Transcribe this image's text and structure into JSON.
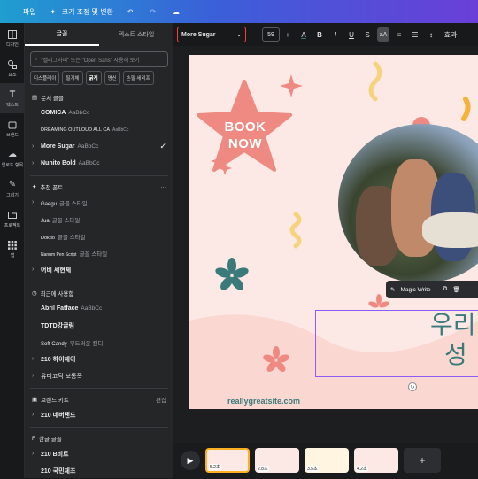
{
  "topbar": {
    "file_label": "파일",
    "resize_label": "크기 조정 및 변환",
    "undo": "undo-icon",
    "redo": "redo-icon",
    "cloud": "cloud-icon"
  },
  "rail": [
    {
      "label": "디자인"
    },
    {
      "label": "요소"
    },
    {
      "label": "텍스트"
    },
    {
      "label": "브랜드"
    },
    {
      "label": "업로드 항목"
    },
    {
      "label": "그리기"
    },
    {
      "label": "프로젝트"
    },
    {
      "label": "앱"
    }
  ],
  "panel": {
    "tabs": [
      "글꼴",
      "텍스트 스타일"
    ],
    "search_placeholder": "\"캘리그라피\" 또는 \"Open Sans\" 사용해 보기",
    "chips": [
      "디스플레이",
      "필기체",
      "굵게",
      "명신",
      "손필 세리프"
    ],
    "section_doc": "문서 글꼴",
    "doc_fonts": [
      {
        "name": "COMICA",
        "sample": "AaBbCc"
      },
      {
        "name": "DREAMING OUTLOUD ALL CA",
        "sample": "AaBbCc"
      },
      {
        "name": "More Sugar",
        "sample": "AaBbCc",
        "checked": true
      },
      {
        "name": "Nunito Bold",
        "sample": "AaBbCc"
      }
    ],
    "section_recommended": "추천 폰트",
    "rec_fonts": [
      {
        "name": "Gaegu",
        "sample": "글꼴 스타일"
      },
      {
        "name": "Jua",
        "sample": "글꼴 스타일"
      },
      {
        "name": "Dokdo",
        "sample": "글꼴 스타일"
      },
      {
        "name": "Nanum Pen Script",
        "sample": "글꼴 스타일"
      },
      {
        "name": "어비 세현체",
        "sample": ""
      }
    ],
    "section_recent": "최근에 사용함",
    "recent_fonts": [
      {
        "name": "Abril Fatface",
        "sample": "AaBbCc"
      },
      {
        "name": "TDTD강글림",
        "sample": ""
      },
      {
        "name": "Soft Candy",
        "sample": "부드러운 캔디"
      },
      {
        "name": "210 하이헤이",
        "sample": ""
      },
      {
        "name": "유디고딕 보통폭",
        "sample": ""
      }
    ],
    "section_brand": "브랜드 키트",
    "brand_edit": "편집",
    "brand_font": "210 네버랜드",
    "section_korean": "한글 글꼴",
    "korean_fonts": [
      {
        "name": "210 B비트"
      },
      {
        "name": "210 국민체조"
      }
    ]
  },
  "toolbar": {
    "font": "More Sugar",
    "font_size": "59",
    "minus": "−",
    "plus": "+",
    "effects_label": "효과"
  },
  "canvas": {
    "badge_line1": "BOOK",
    "badge_line2": "NOW",
    "url": "reallygreatsite.com",
    "heading_line1": "우리",
    "heading_line2": "성",
    "magic_write": "Magic Write"
  },
  "timeline": {
    "pages": [
      {
        "duration": "5.2초",
        "active": true
      },
      {
        "duration": "2.8초",
        "active": false
      },
      {
        "duration": "3.5초",
        "active": false
      },
      {
        "duration": "4.2초",
        "active": false
      }
    ]
  },
  "colors": {
    "accent_red": "#ff3b3b",
    "selection_purple": "#8b5cf6",
    "teal_text": "#3b7a7a",
    "star_pink": "#ee8a82",
    "artboard_bg": "#fce9e6"
  }
}
